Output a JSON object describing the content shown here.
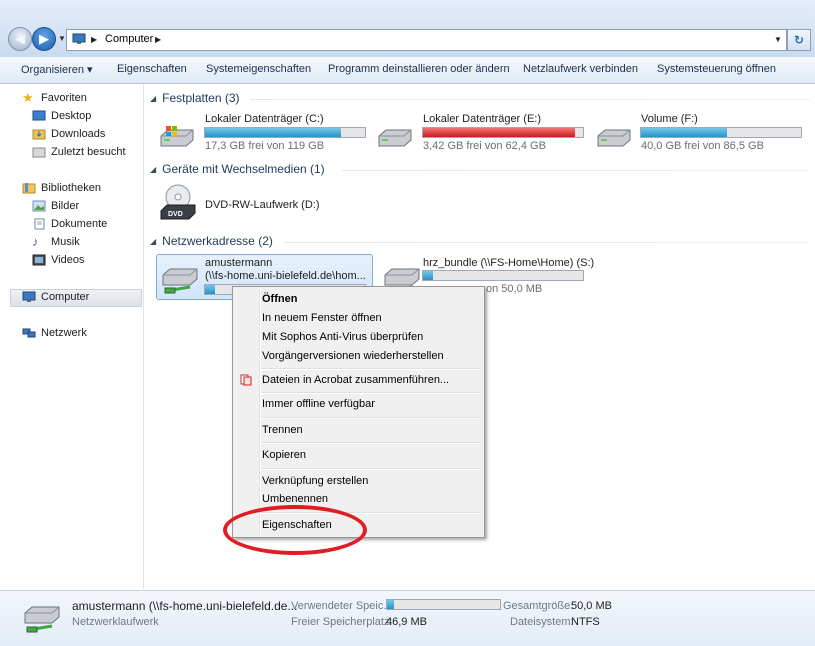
{
  "address": {
    "path": [
      "Computer"
    ],
    "back_icon": "back-arrow-icon",
    "forward_icon": "forward-arrow-icon",
    "refresh_icon": "refresh-icon"
  },
  "toolbar": {
    "organize": "Organisieren ▾",
    "properties": "Eigenschaften",
    "system_properties": "Systemeigenschaften",
    "uninstall": "Programm deinstallieren oder ändern",
    "map_drive": "Netzlaufwerk verbinden",
    "control_panel": "Systemsteuerung öffnen"
  },
  "nav": {
    "favorites": "Favoriten",
    "desktop": "Desktop",
    "downloads": "Downloads",
    "recent": "Zuletzt besucht",
    "libraries": "Bibliotheken",
    "pictures": "Bilder",
    "documents": "Dokumente",
    "music": "Musik",
    "videos": "Videos",
    "computer": "Computer",
    "network": "Netzwerk"
  },
  "groups": {
    "hard_drives": "Festplatten (3)",
    "removable": "Geräte mit Wechselmedien (1)",
    "network": "Netzwerkadresse (2)"
  },
  "drives": [
    {
      "name": "Lokaler Datenträger (C:)",
      "free": "17,3 GB frei von 119 GB",
      "used_fraction": 0.85,
      "color": "#2693c9"
    },
    {
      "name": "Lokaler Datenträger (E:)",
      "free": "3,42 GB frei von 62,4 GB",
      "used_fraction": 0.95,
      "color": "#cc1b1b"
    },
    {
      "name": "Volume (F:)",
      "free": "40,0 GB frei von 86,5 GB",
      "used_fraction": 0.54,
      "color": "#2693c9"
    }
  ],
  "dvd": {
    "name": "DVD-RW-Laufwerk (D:)",
    "icon_label": "DVD"
  },
  "network_drives": [
    {
      "name": "amustermann",
      "path": "(\\\\fs-home.uni-bielefeld.de\\hom...",
      "used_fraction": 0.06
    },
    {
      "name": "hrz_bundle (\\\\FS-Home\\Home) (S:)",
      "free": "46,9 MB frei von 50,0 MB",
      "free_visible": "on 50,0 MB",
      "used_fraction": 0.06
    }
  ],
  "context_menu": {
    "open": "Öffnen",
    "open_new_window": "In neuem Fenster öffnen",
    "sophos": "Mit Sophos Anti-Virus überprüfen",
    "restore": "Vorgängerversionen wiederherstellen",
    "acrobat": "Dateien in Acrobat zusammenführen...",
    "offline": "Immer offline verfügbar",
    "disconnect": "Trennen",
    "copy": "Kopieren",
    "shortcut": "Verknüpfung erstellen",
    "rename": "Umbenennen",
    "properties": "Eigenschaften"
  },
  "details": {
    "title": "amustermann (\\\\fs-home.uni-bielefeld.de...",
    "type": "Netzwerklaufwerk",
    "used_label": "Verwendeter Speic...",
    "used_fraction": 0.06,
    "free_label": "Freier Speicherplatz:",
    "free_value": "46,9 MB",
    "total_label": "Gesamtgröße:",
    "total_value": "50,0 MB",
    "fs_label": "Dateisystem:",
    "fs_value": "NTFS"
  },
  "colors": {
    "highlight_ring": "#e01c24",
    "bar_normal": "#2693c9",
    "bar_full": "#cc1b1b"
  }
}
